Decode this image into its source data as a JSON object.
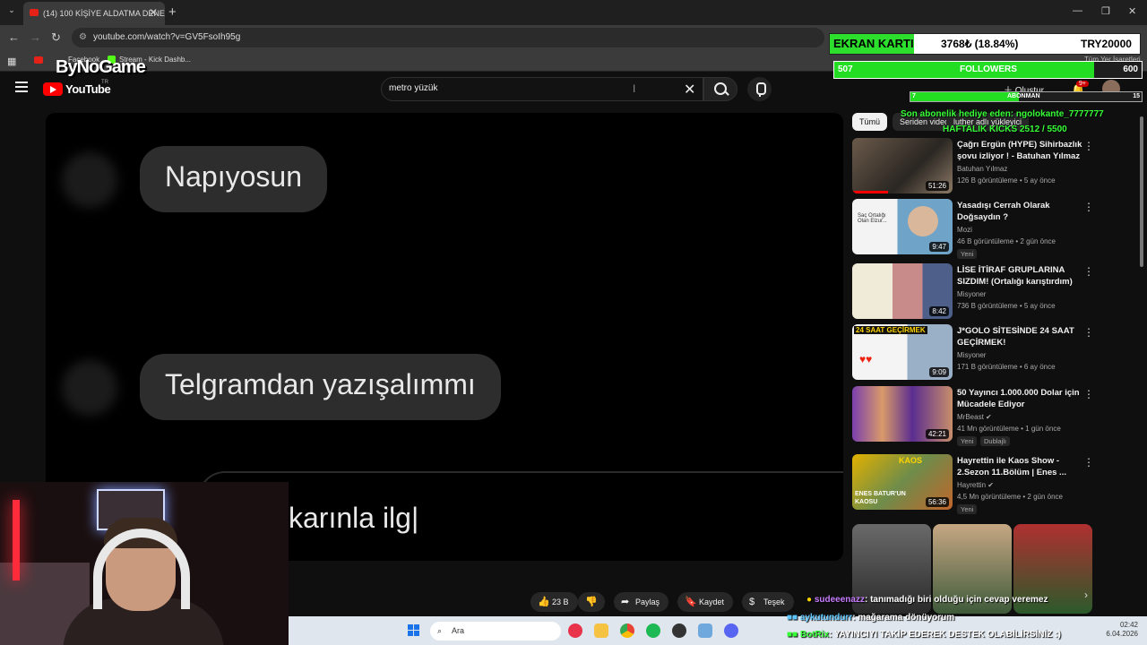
{
  "browser": {
    "tab_title": "(14) 100 KİŞİYE ALDATMA DENE",
    "url": "youtube.com/watch?v=GV5FsoIh95g",
    "bookmarks": [
      "Facebook",
      "Stream - Kick Dashb..."
    ],
    "all_bookmarks": "Tüm Yer İşaretleri"
  },
  "youtube": {
    "logo_text": "YouTube",
    "region": "TR",
    "search_value": "metro yüzük",
    "create_label": "Oluştur",
    "notif_badge": "9+"
  },
  "video": {
    "bubble1": "Napıyosun",
    "bubble2": "Telgramdan yazışalımmı",
    "partial_text": "karınla ilg"
  },
  "actions": {
    "like": "23 B",
    "share": "Paylaş",
    "save": "Kaydet",
    "thanks": "Teşek"
  },
  "sidebar": {
    "chips": [
      "Tümü",
      "Seriden videolar",
      "luther adlı yükleyici"
    ],
    "recs": [
      {
        "title": "Çağrı Ergün (HYPE) Sihirbazlık şovu izliyor ! - Batuhan Yılmaz",
        "channel": "Batuhan Yılmaz",
        "meta": "126 B görüntüleme • 5 ay önce",
        "duration": "51:26",
        "badge": ""
      },
      {
        "title": "Yasadışı Cerrah Olarak Doğsaydın ?",
        "channel": "Mozi",
        "meta": "46 B görüntüleme • 2 gün önce",
        "duration": "9:47",
        "badge": "Yeni"
      },
      {
        "title": "LİSE İTİRAF GRUPLARINA SIZDIM! (Ortalığı karıştırdım)",
        "channel": "Misyoner",
        "meta": "736 B görüntüleme • 5 ay önce",
        "duration": "8:42",
        "badge": ""
      },
      {
        "title": "J*GOLO SİTESİNDE 24 SAAT GEÇİRMEK!",
        "channel": "Misyoner",
        "meta": "171 B görüntüleme • 6 ay önce",
        "duration": "9:09",
        "badge": ""
      },
      {
        "title": "50 Yayıncı 1.000.000 Dolar için Mücadele Ediyor",
        "channel": "MrBeast",
        "meta": "41 Mn görüntüleme • 1 gün önce",
        "duration": "42:21",
        "badge": "Yeni",
        "badge2": "Dublajlı"
      },
      {
        "title": "Hayrettin ile Kaos Show - 2.Sezon 11.Bölüm | Enes ...",
        "channel": "Hayrettin",
        "meta": "4,5 Mn görüntüleme • 2 gün önce",
        "duration": "56:36",
        "badge": "Yeni"
      }
    ],
    "thumb_text": {
      "r2": "Saç Ortalığı Olan Elzur...",
      "r4": "24 SAAT GEÇİRMEK",
      "r6a": "KAOS",
      "r6b": "ENES BATUR'UN KAOSU"
    }
  },
  "overlay": {
    "brand": "ByNoGame",
    "ekran_label": "EKRAN KARTI",
    "ekran_value": "3768₺ (18.84%)",
    "ekran_target": "TRY20000",
    "followers_current": "507",
    "followers_label": "FOLLOWERS",
    "followers_target": "600",
    "followers_progress": 0.845,
    "abone_label": "ABONMAN",
    "abone_current": "7",
    "abone_target": "15",
    "abone_progress": 0.47,
    "last_sub": "Son abonelik hediye eden: ngolokante_7777777",
    "weekly_kicks": "HAFTALIK KICKS 2512 / 5500"
  },
  "chat": [
    {
      "user": "sudeeenazz",
      "message": ": tanımadığı biri olduğu için cevap veremez"
    },
    {
      "user": "aykutundurr",
      "message": ": mağarama dönüyorum"
    },
    {
      "user": "BotRix",
      "message": ": YAYINCIYI TAKİP EDEREK DESTEK OLABİLİRSİNİZ :)"
    }
  ],
  "taskbar": {
    "search_placeholder": "Ara",
    "time": "02:42",
    "date": "6.04.2026"
  },
  "colors": {
    "accent_green": "#22dd22",
    "youtube_red": "#ff0000"
  }
}
